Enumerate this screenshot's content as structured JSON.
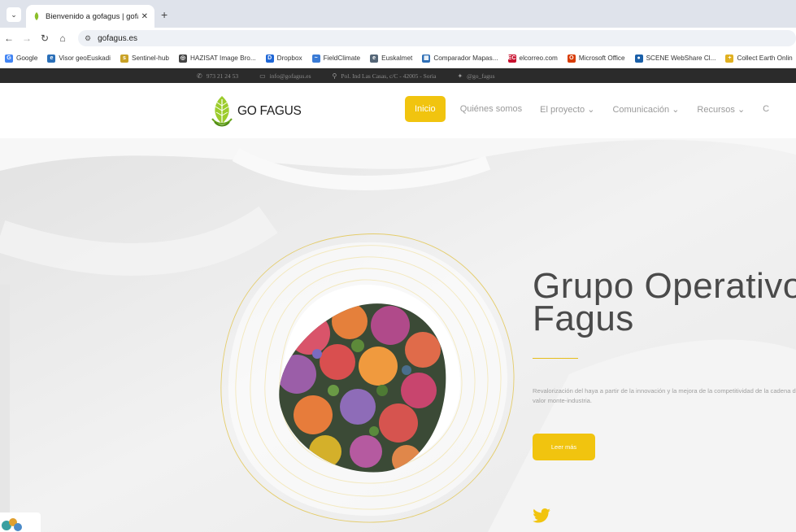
{
  "browser": {
    "tab_title": "Bienvenido a gofagus | gofagus",
    "tab_close": "✕",
    "new_tab": "+",
    "url": "gofagus.es",
    "bookmarks": [
      {
        "label": "Google",
        "icon": "google-icon",
        "color": "#4285f4",
        "glyph": "G"
      },
      {
        "label": "Visor geoEuskadi",
        "icon": "geoeuskadi-icon",
        "color": "#2a6fb8",
        "glyph": "e"
      },
      {
        "label": "Sentinel-hub",
        "icon": "sentinel-icon",
        "color": "#c9a227",
        "glyph": "s"
      },
      {
        "label": "HAZISAT Image Bro...",
        "icon": "globe-icon",
        "color": "#444444",
        "glyph": "◎"
      },
      {
        "label": "Dropbox",
        "icon": "dropbox-icon",
        "color": "#1e66d6",
        "glyph": "D"
      },
      {
        "label": "FieldClimate",
        "icon": "fieldclimate-icon",
        "color": "#3a7bd5",
        "glyph": "~"
      },
      {
        "label": "Euskalmet",
        "icon": "euskalmet-icon",
        "color": "#556677",
        "glyph": "e"
      },
      {
        "label": "Comparador Mapas...",
        "icon": "map-icon",
        "color": "#2f6fb6",
        "glyph": "▦"
      },
      {
        "label": "elcorreo.com",
        "icon": "elcorreo-icon",
        "color": "#c8102e",
        "glyph": "EC"
      },
      {
        "label": "Microsoft Office",
        "icon": "office-icon",
        "color": "#d83b01",
        "glyph": "O"
      },
      {
        "label": "SCENE WebShare Cl...",
        "icon": "scene-icon",
        "color": "#1a5fa8",
        "glyph": "●"
      },
      {
        "label": "Collect Earth Onlin",
        "icon": "collect-earth-icon",
        "color": "#e0b020",
        "glyph": "+"
      }
    ]
  },
  "topbar": {
    "phone": "973 21 24 53",
    "email": "info@gofagus.es",
    "address": "Pol. Ind Las Casas, c/C - 42005 - Soria",
    "twitter": "@go_fagus"
  },
  "header": {
    "logo_text": "GO FAGUS",
    "menu": [
      {
        "label": "Inicio",
        "active": true
      },
      {
        "label": "Quiénes somos"
      },
      {
        "label": "El proyecto ⌄"
      },
      {
        "label": "Comunicación ⌄"
      },
      {
        "label": "Recursos ⌄"
      },
      {
        "label": "C"
      }
    ]
  },
  "hero": {
    "title": "Grupo Operativo Fagus",
    "subtitle": "Revalorización del haya a partir de la innovación y la mejora de la competitividad de la cadena de valor monte-industria.",
    "button": "Leer más"
  },
  "colors": {
    "accent": "#f1c40f",
    "dark_bar": "#2b2b2b"
  }
}
